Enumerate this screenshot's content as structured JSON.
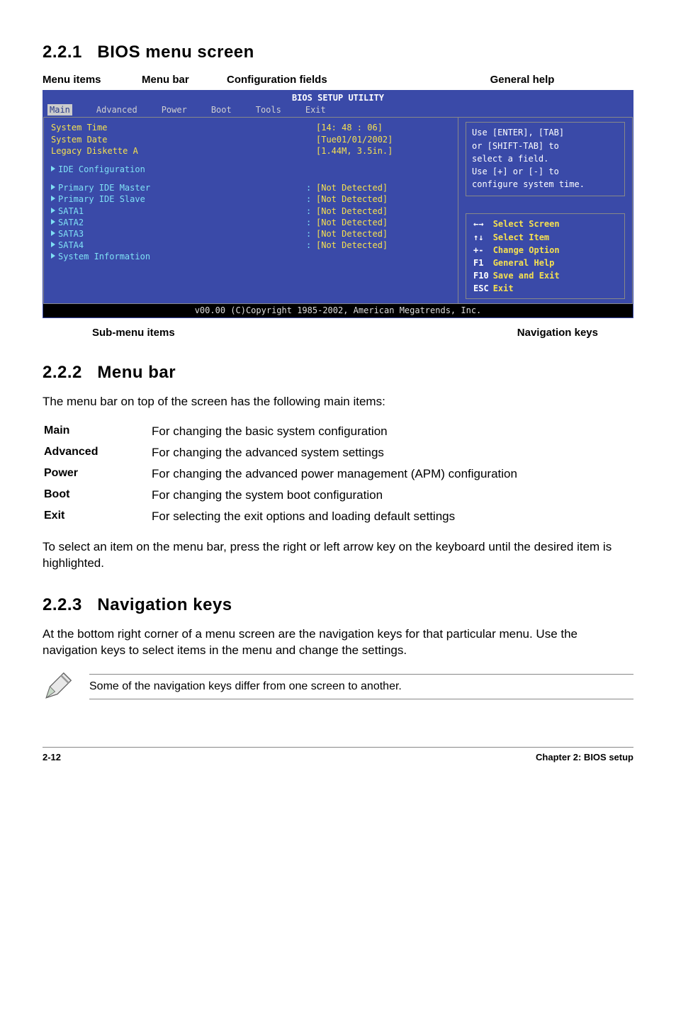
{
  "sections": {
    "s1": {
      "num": "2.2.1",
      "title": "BIOS menu screen"
    },
    "s2": {
      "num": "2.2.2",
      "title": "Menu bar"
    },
    "s3": {
      "num": "2.2.3",
      "title": "Navigation keys"
    }
  },
  "diagram_labels": {
    "menu_items": "Menu items",
    "menu_bar": "Menu bar",
    "config_fields": "Configuration fields",
    "general_help": "General help",
    "sub_menu": "Sub-menu items",
    "nav_keys": "Navigation keys"
  },
  "bios": {
    "title": "BIOS SETUP UTILITY",
    "tabs": {
      "main": "Main",
      "advanced": "Advanced",
      "power": "Power",
      "boot": "Boot",
      "tools": "Tools",
      "exit": "Exit"
    },
    "rows": {
      "sys_time": {
        "label": "System Time",
        "value": "[14: 48 : 06]"
      },
      "sys_date": {
        "label": "System Date",
        "value": "[Tue01/01/2002]"
      },
      "legacy": {
        "label": "Legacy Diskette A",
        "value": "[1.44M, 3.5in.]"
      },
      "ide_cfg": {
        "label": "IDE Configuration"
      },
      "pri_m": {
        "label": "Primary IDE Master",
        "value": "[Not Detected]"
      },
      "pri_s": {
        "label": "Primary IDE Slave",
        "value": "[Not Detected]"
      },
      "sata1": {
        "label": "SATA1",
        "value": "[Not Detected]"
      },
      "sata2": {
        "label": "SATA2",
        "value": "[Not Detected]"
      },
      "sata3": {
        "label": "SATA3",
        "value": "[Not Detected]"
      },
      "sata4": {
        "label": "SATA4",
        "value": "[Not Detected]"
      },
      "sysinfo": {
        "label": "System Information"
      }
    },
    "help_top": {
      "l1": "Use [ENTER], [TAB]",
      "l2": "or [SHIFT-TAB] to",
      "l3": "select a field.",
      "l4": "Use [+] or [-] to",
      "l5": "configure system time."
    },
    "help_bot": {
      "r1": {
        "key": "←→",
        "desc": "Select Screen"
      },
      "r2": {
        "key": "↑↓",
        "desc": "Select Item"
      },
      "r3": {
        "key": "+-",
        "desc": "Change Option"
      },
      "r4": {
        "key": "F1",
        "desc": "General Help"
      },
      "r5": {
        "key": "F10",
        "desc": "Save and Exit"
      },
      "r6": {
        "key": "ESC",
        "desc": "Exit"
      }
    },
    "copyright": "v00.00 (C)Copyright 1985-2002, American Megatrends, Inc."
  },
  "s2_intro": "The menu bar on top of the screen has the following main items:",
  "s2_defs": {
    "main": {
      "term": "Main",
      "desc": "For changing the basic system configuration"
    },
    "advanced": {
      "term": "Advanced",
      "desc": "For changing the advanced system settings"
    },
    "power": {
      "term": "Power",
      "desc": "For changing the advanced power management (APM) configuration"
    },
    "boot": {
      "term": "Boot",
      "desc": "For changing the system boot configuration"
    },
    "exit": {
      "term": "Exit",
      "desc": "For selecting the exit options and loading default settings"
    }
  },
  "s2_outro": "To select an item on the menu bar, press the right or left arrow key on the keyboard until the desired item is highlighted.",
  "s3_para": "At the bottom right corner of a menu screen are the navigation keys for that particular menu. Use the navigation keys to select items in the menu and change the settings.",
  "note": "Some of the navigation keys differ from one screen to another.",
  "footer": {
    "page": "2-12",
    "chapter": "Chapter 2: BIOS setup"
  }
}
